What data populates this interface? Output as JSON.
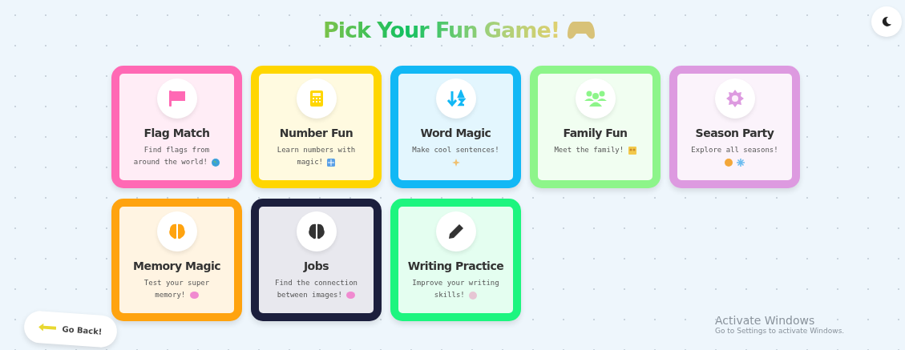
{
  "title": "Pick Your Fun Game!",
  "theme_toggle": {
    "selected": false
  },
  "games": [
    {
      "name": "Flag Match",
      "description": "Find flags from around the world!",
      "color": "#ff69b4"
    },
    {
      "name": "Number Fun",
      "description": "Learn numbers with magic!",
      "color": "#ffd600"
    },
    {
      "name": "Word Magic",
      "description": "Make cool sentences!",
      "color": "#12b8f5"
    },
    {
      "name": "Family Fun",
      "description": "Meet the family!",
      "color": "#8df58a"
    },
    {
      "name": "Season Party",
      "description": "Explore all seasons!",
      "color": "#dd9ae0"
    },
    {
      "name": "Memory Magic",
      "description": "Test your super memory!",
      "color": "#ffa30f"
    },
    {
      "name": "Jobs",
      "description": "Find the connection between images!",
      "color": "#1c1f3d"
    },
    {
      "name": "Writing Practice",
      "description": "Improve your writing skills!",
      "color": "#1df57f"
    }
  ],
  "back_button": {
    "label": "Go Back!"
  },
  "os_notice": {
    "title": "Activate Windows",
    "subtitle": "Go to Settings to activate Windows."
  }
}
